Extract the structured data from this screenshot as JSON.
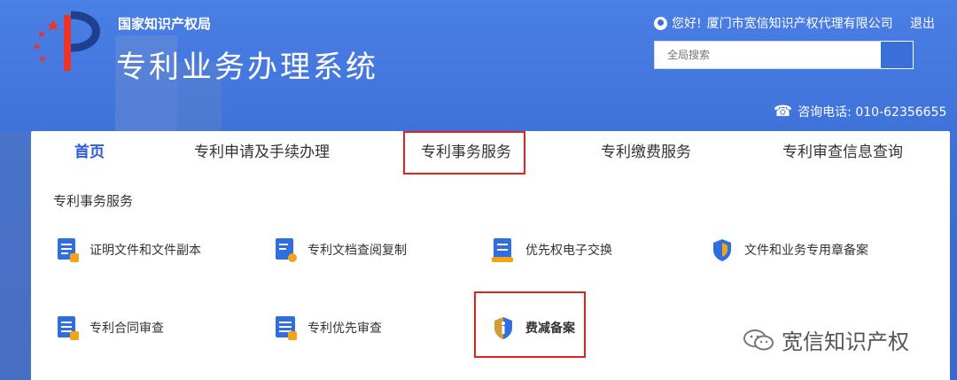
{
  "header": {
    "org_name": "国家知识产权局",
    "system_name": "专利业务办理系统",
    "greeting": "您好!",
    "company": "厦门市宽信知识产权代理有限公司",
    "logout": "退出",
    "search": {
      "placeholder": "全局搜索",
      "value": ""
    },
    "phone": "咨询电话: 010-62356655"
  },
  "nav": {
    "tabs": [
      {
        "label": "首页",
        "active": true
      },
      {
        "label": "专利申请及手续办理",
        "active": false
      },
      {
        "label": "专利事务服务",
        "active": false,
        "highlighted": true
      },
      {
        "label": "专利缴费服务",
        "active": false
      },
      {
        "label": "专利审查信息查询",
        "active": false
      }
    ]
  },
  "section": {
    "title": "专利事务服务",
    "items": [
      {
        "label": "证明文件和文件副本",
        "icon": "certificate-doc-icon"
      },
      {
        "label": "专利文档查阅复制",
        "icon": "doc-search-icon"
      },
      {
        "label": "优先权电子交换",
        "icon": "exchange-icon"
      },
      {
        "label": "文件和业务专用章备案",
        "icon": "shield-seal-icon"
      },
      {
        "label": "专利合同审查",
        "icon": "contract-doc-icon"
      },
      {
        "label": "专利优先审查",
        "icon": "priority-list-icon"
      },
      {
        "label": "费减备案",
        "icon": "info-shield-icon",
        "highlighted": true
      }
    ]
  },
  "watermark": "宽信知识产权",
  "colors": {
    "header_blue": "#3d6fd6",
    "active_tab": "#2a5bd7",
    "highlight_red": "#e2231a",
    "icon_blue": "#2f6ee0",
    "icon_orange": "#f2a318"
  }
}
